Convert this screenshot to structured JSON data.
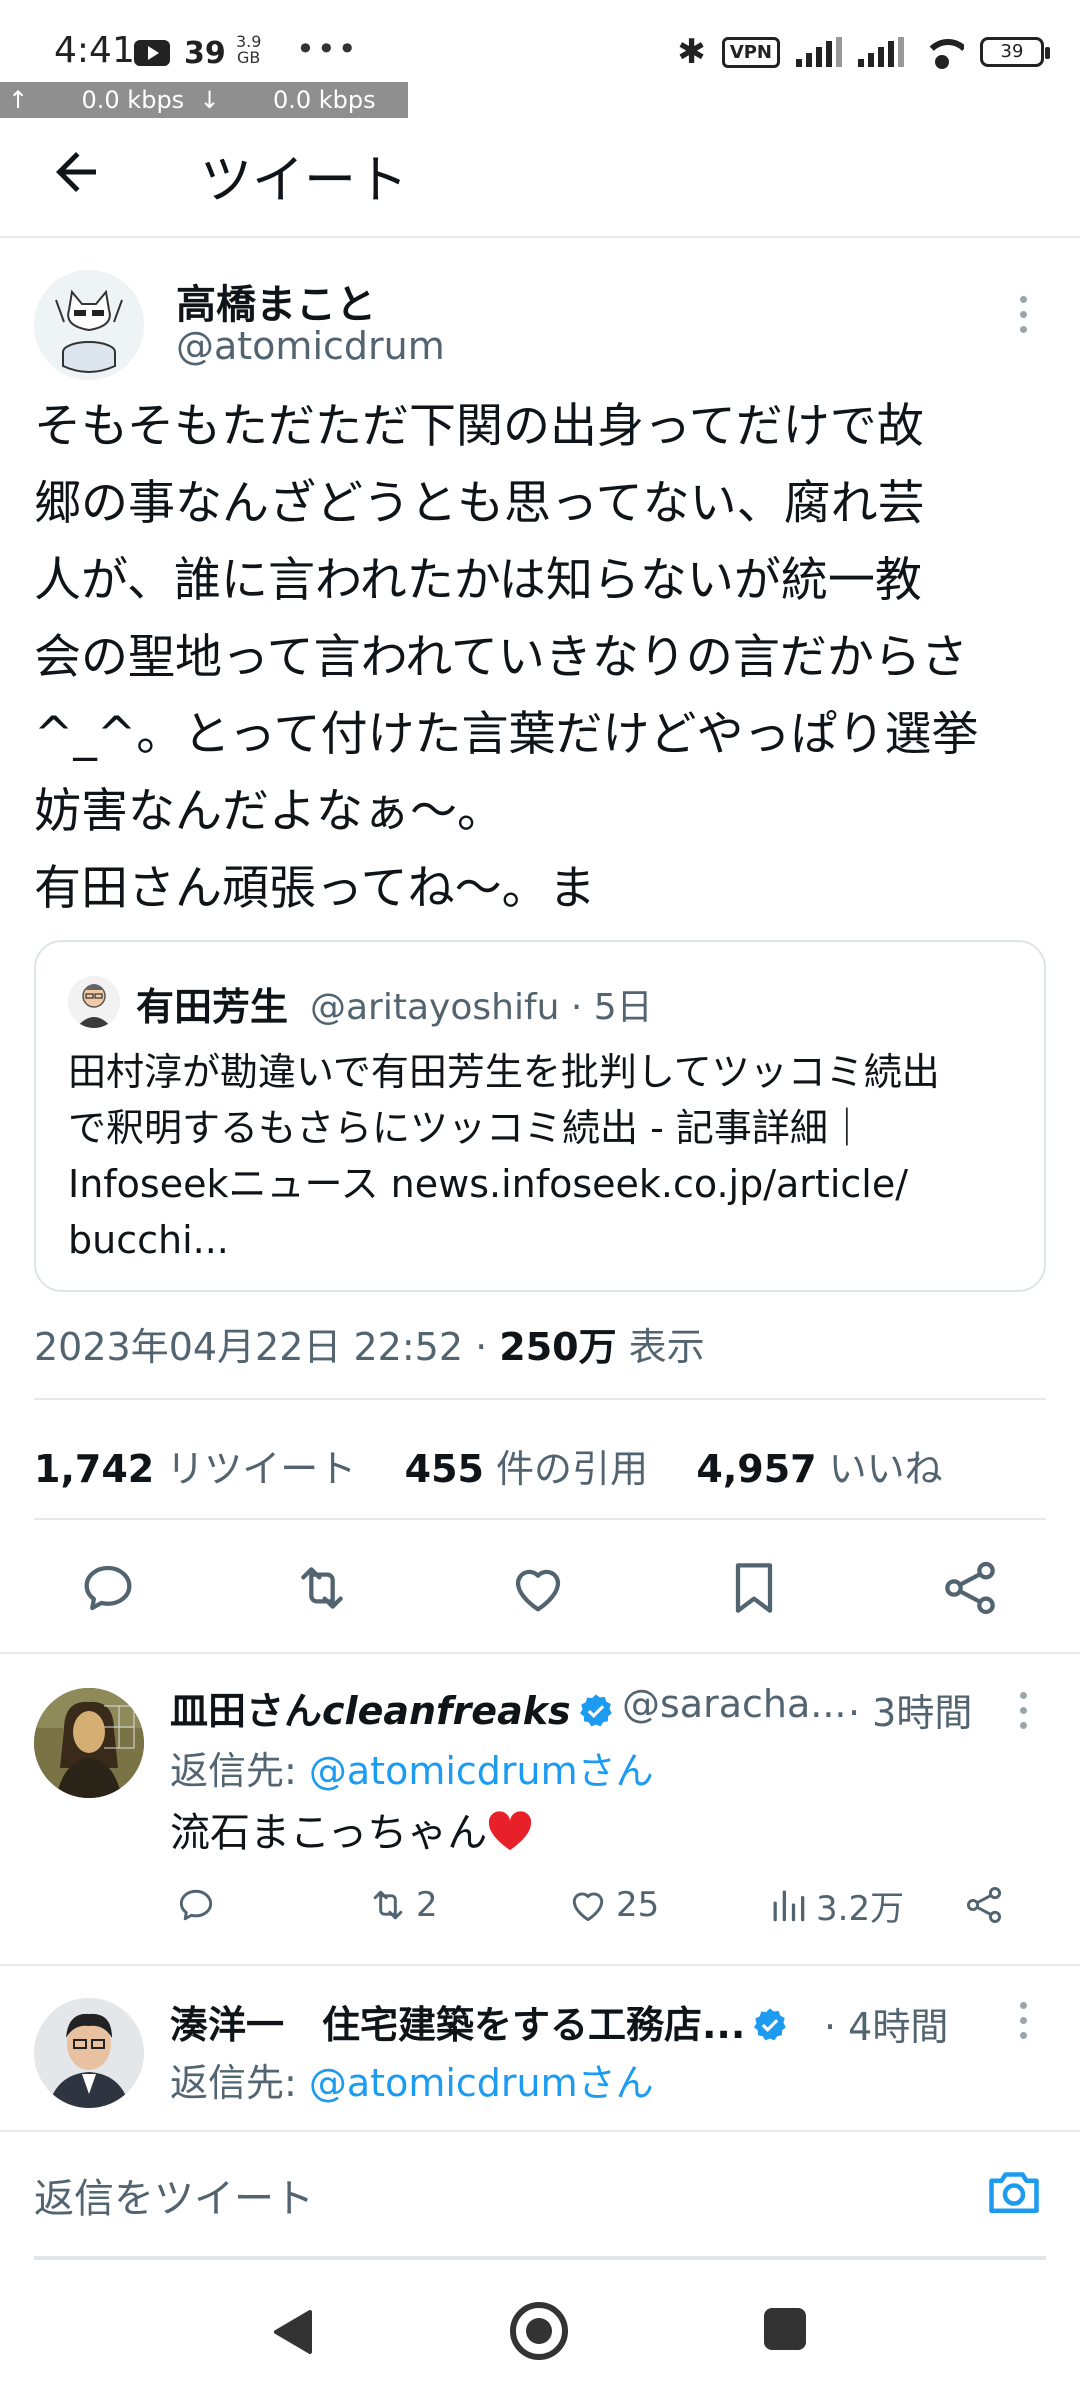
{
  "status_bar": {
    "time": "4:41",
    "badge_count": "39",
    "storage_value": "3.9",
    "storage_unit": "GB",
    "more": "•••",
    "vpn": "VPN",
    "battery": "39",
    "netspeed": "↑       0.0 kbps  ↓       0.0 kbps"
  },
  "header": {
    "title": "ツイート"
  },
  "tweet": {
    "author_name": "高橋まこと",
    "author_handle": "@atomicdrum",
    "text": "そもそもただただ下関の出身ってだけで故\n郷の事なんざどうとも思ってない、腐れ芸\n人が、誰に言われたかは知らないが統一教\n会の聖地って言われていきなりの言だからさ\n^_^。とって付けた言葉だけどやっぱり選挙\n妨害なんだよなぁ〜。\n有田さん頑張ってね〜。ま",
    "quote": {
      "author_name": "有田芳生",
      "meta": "@aritayoshifu · 5日",
      "text": "田村淳が勘違いで有田芳生を批判してツッコミ続出\nで釈明するもさらにツッコミ続出 - 記事詳細｜\nInfoseekニュース news.infoseek.co.jp/article/\nbucchi..."
    },
    "timestamp": "2023年04月22日 22:52 · ",
    "views_count": "250万",
    "views_label": " 表示",
    "stats": {
      "retweets_count": "1,742",
      "retweets_label": " リツイート",
      "quotes_count": "455",
      "quotes_label": " 件の引用",
      "likes_count": "4,957",
      "likes_label": " いいね"
    }
  },
  "replies": [
    {
      "name_prefix": "皿田さん",
      "name_italic": "cleanfreaks",
      "handle": "@saracha...",
      "time": " · 3時間",
      "reply_to_label": "返信先: ",
      "reply_to_link": "@atomicdrumさん",
      "text": "流石まこっちゃん",
      "retweets": "2",
      "likes": "25",
      "views": "3.2万"
    },
    {
      "name": "湊洋一　住宅建築をする工務店...",
      "time": " · 4時間",
      "reply_to_label": "返信先: ",
      "reply_to_link": "@atomicdrumさん"
    }
  ],
  "compose": {
    "placeholder": "返信をツイート"
  },
  "colors": {
    "accent": "#1d9bf0",
    "secondary_text": "#536471",
    "primary_text": "#0f1419"
  }
}
